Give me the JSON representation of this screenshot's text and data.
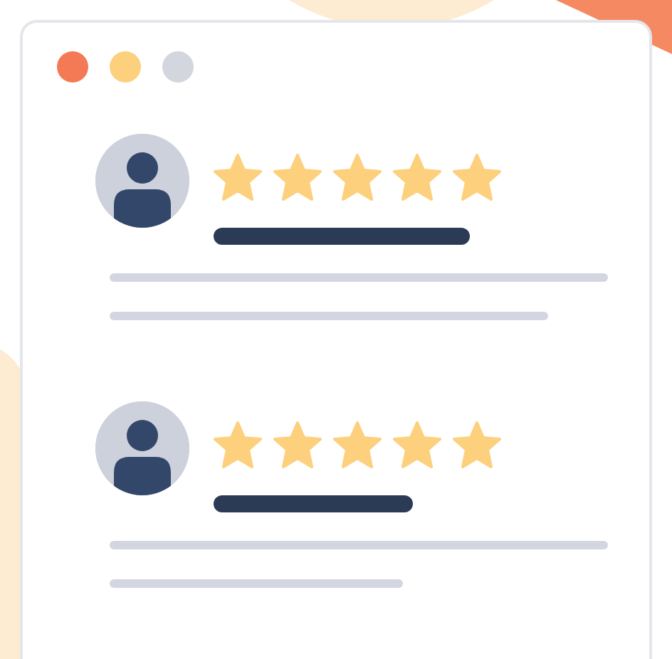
{
  "window": {
    "controls": [
      {
        "color": "#f47a55"
      },
      {
        "color": "#fdd07e"
      },
      {
        "color": "#d3d6df"
      }
    ]
  },
  "reviews": [
    {
      "stars": 5
    },
    {
      "stars": 5
    }
  ]
}
